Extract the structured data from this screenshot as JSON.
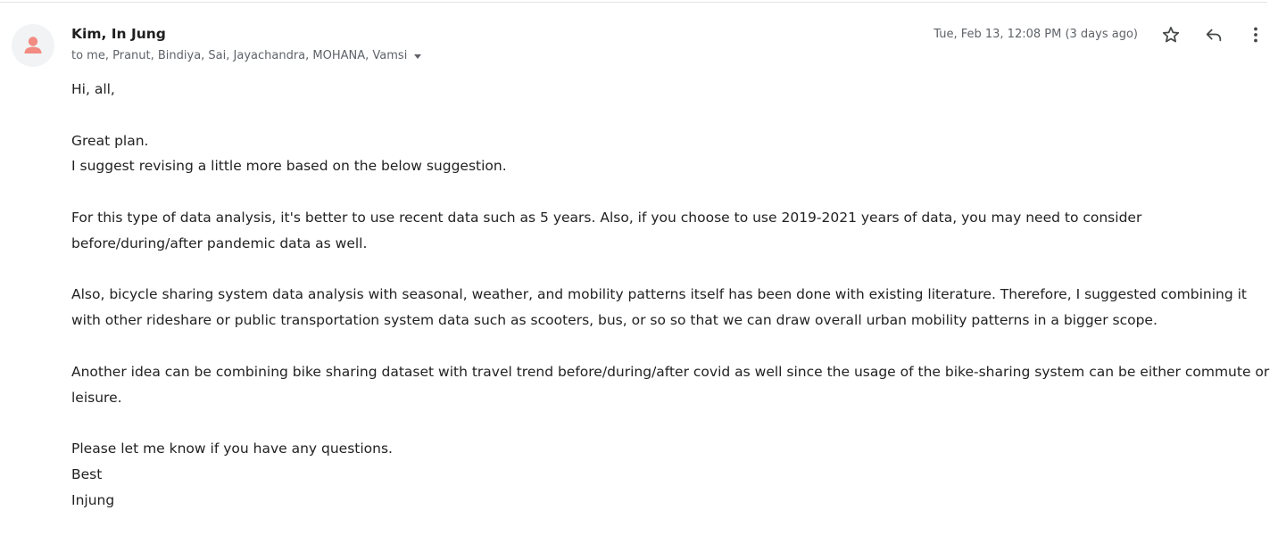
{
  "message": {
    "sender_name": "Kim, In Jung",
    "recipients": "to me, Pranut, Bindiya, Sai, Jayachandra, MOHANA, Vamsi",
    "timestamp": "Tue, Feb 13, 12:08 PM (3 days ago)",
    "body": {
      "greeting": "Hi, all,",
      "para1_line1": "Great plan.",
      "para1_line2": "I suggest revising a little more based on the below suggestion.",
      "para2": "For this type of data analysis, it's better to use recent data such as 5 years. Also, if you choose to use 2019-2021 years of data, you may need to consider before/during/after pandemic data as well.",
      "para3": "Also, bicycle sharing system data analysis with seasonal, weather, and mobility patterns itself has been done with existing literature. Therefore, I suggested combining it with other rideshare or public transportation system data such as scooters, bus, or so so that we can draw overall urban mobility patterns in a bigger scope.",
      "para4": "Another idea can be combining bike sharing dataset with travel trend before/during/after covid as well since the usage of the bike-sharing system can be either commute or leisure.",
      "closing_line1": "Please let me know if you have any questions.",
      "closing_line2": "Best",
      "signature": "Injung"
    }
  },
  "icons": {
    "avatar": "person-avatar-icon",
    "star": "star-outline-icon",
    "reply": "reply-icon",
    "more": "more-vertical-icon",
    "recipients_toggle": "caret-down-icon"
  },
  "colors": {
    "avatar_bg": "#f1f3f4",
    "avatar_figure": "#f28b82",
    "secondary_text": "#5f6368",
    "body_text": "#222222"
  }
}
